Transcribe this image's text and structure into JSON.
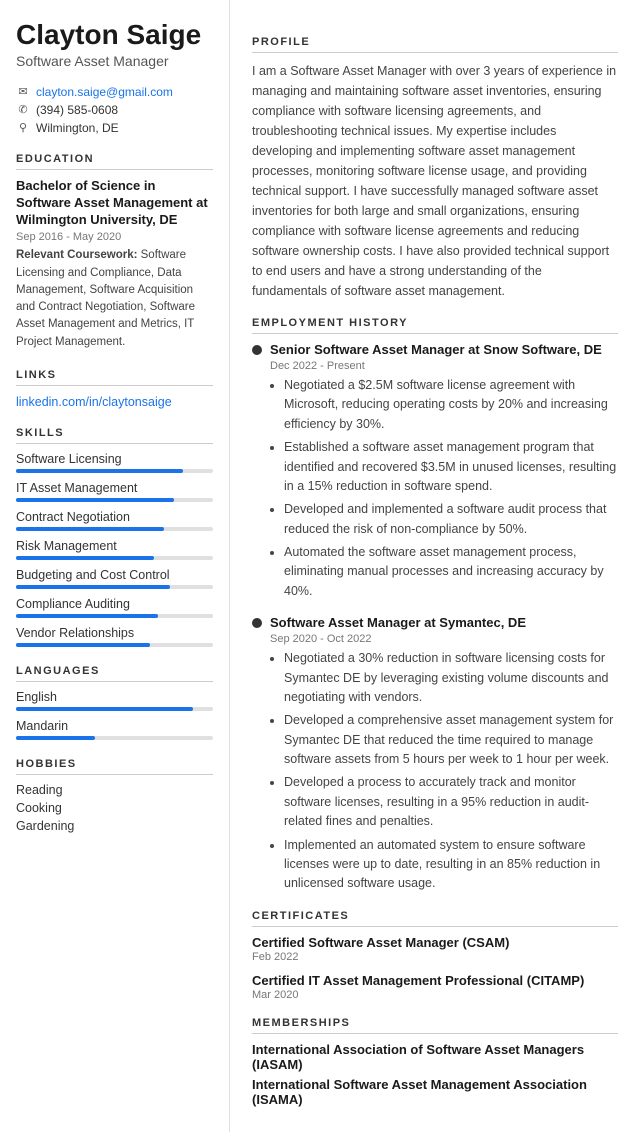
{
  "sidebar": {
    "name": "Clayton Saige",
    "job_title": "Software Asset Manager",
    "contact": {
      "email": "clayton.saige@gmail.com",
      "phone": "(394) 585-0608",
      "location": "Wilmington, DE"
    },
    "education": {
      "section_label": "EDUCATION",
      "degree": "Bachelor of Science in Software Asset Management at Wilmington University, DE",
      "dates": "Sep 2016 - May 2020",
      "coursework_label": "Relevant Coursework:",
      "coursework": "Software Licensing and Compliance, Data Management, Software Acquisition and Contract Negotiation, Software Asset Management and Metrics, IT Project Management."
    },
    "links": {
      "section_label": "LINKS",
      "linkedin": "linkedin.com/in/claytonsaige"
    },
    "skills": {
      "section_label": "SKILLS",
      "items": [
        {
          "label": "Software Licensing",
          "percent": 85
        },
        {
          "label": "IT Asset Management",
          "percent": 80
        },
        {
          "label": "Contract Negotiation",
          "percent": 75
        },
        {
          "label": "Risk Management",
          "percent": 70
        },
        {
          "label": "Budgeting and Cost Control",
          "percent": 78
        },
        {
          "label": "Compliance Auditing",
          "percent": 72
        },
        {
          "label": "Vendor Relationships",
          "percent": 68
        }
      ]
    },
    "languages": {
      "section_label": "LANGUAGES",
      "items": [
        {
          "label": "English",
          "percent": 90
        },
        {
          "label": "Mandarin",
          "percent": 40
        }
      ]
    },
    "hobbies": {
      "section_label": "HOBBIES",
      "items": [
        "Reading",
        "Cooking",
        "Gardening"
      ]
    }
  },
  "main": {
    "profile": {
      "section_label": "PROFILE",
      "text": "I am a Software Asset Manager with over 3 years of experience in managing and maintaining software asset inventories, ensuring compliance with software licensing agreements, and troubleshooting technical issues. My expertise includes developing and implementing software asset management processes, monitoring software license usage, and providing technical support. I have successfully managed software asset inventories for both large and small organizations, ensuring compliance with software license agreements and reducing software ownership costs. I have also provided technical support to end users and have a strong understanding of the fundamentals of software asset management."
    },
    "employment": {
      "section_label": "EMPLOYMENT HISTORY",
      "jobs": [
        {
          "title": "Senior Software Asset Manager at Snow Software, DE",
          "dates": "Dec 2022 - Present",
          "bullets": [
            "Negotiated a $2.5M software license agreement with Microsoft, reducing operating costs by 20% and increasing efficiency by 30%.",
            "Established a software asset management program that identified and recovered $3.5M in unused licenses, resulting in a 15% reduction in software spend.",
            "Developed and implemented a software audit process that reduced the risk of non-compliance by 50%.",
            "Automated the software asset management process, eliminating manual processes and increasing accuracy by 40%."
          ]
        },
        {
          "title": "Software Asset Manager at Symantec, DE",
          "dates": "Sep 2020 - Oct 2022",
          "bullets": [
            "Negotiated a 30% reduction in software licensing costs for Symantec DE by leveraging existing volume discounts and negotiating with vendors.",
            "Developed a comprehensive asset management system for Symantec DE that reduced the time required to manage software assets from 5 hours per week to 1 hour per week.",
            "Developed a process to accurately track and monitor software licenses, resulting in a 95% reduction in audit-related fines and penalties.",
            "Implemented an automated system to ensure software licenses were up to date, resulting in an 85% reduction in unlicensed software usage."
          ]
        }
      ]
    },
    "certificates": {
      "section_label": "CERTIFICATES",
      "items": [
        {
          "name": "Certified Software Asset Manager (CSAM)",
          "date": "Feb 2022"
        },
        {
          "name": "Certified IT Asset Management Professional (CITAMP)",
          "date": "Mar 2020"
        }
      ]
    },
    "memberships": {
      "section_label": "MEMBERSHIPS",
      "items": [
        "International Association of Software Asset Managers (IASAM)",
        "International Software Asset Management Association (ISAMA)"
      ]
    }
  }
}
